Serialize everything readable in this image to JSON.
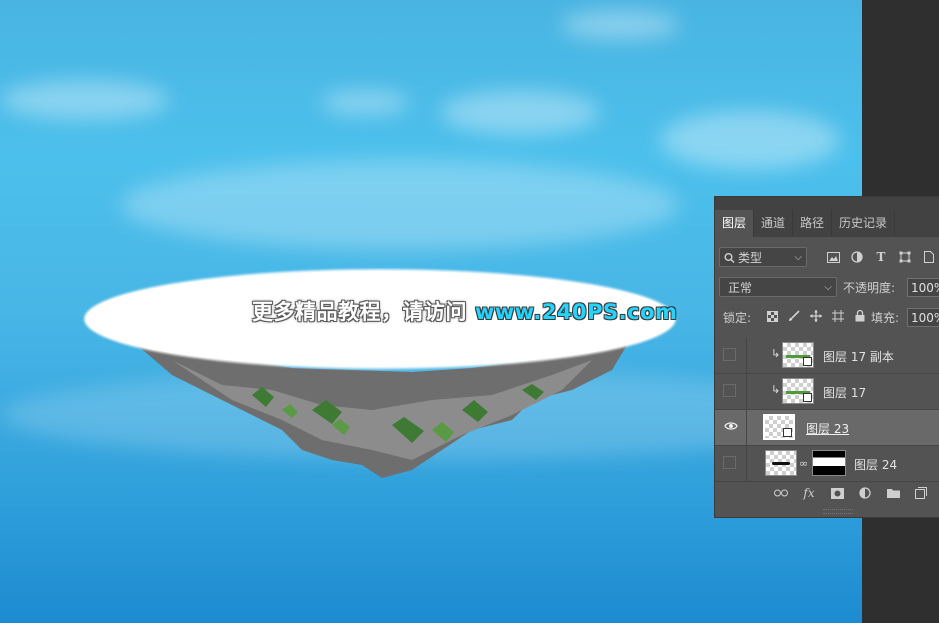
{
  "watermark": {
    "text": "更多精品教程，请访问",
    "url": "www.240PS.com"
  },
  "layers_panel": {
    "tabs": [
      {
        "label": "图层",
        "active": true
      },
      {
        "label": "通道",
        "active": false
      },
      {
        "label": "路径",
        "active": false
      },
      {
        "label": "历史记录",
        "active": false
      }
    ],
    "filter": {
      "search_icon": "search-icon",
      "kind_value": "类型"
    },
    "blend_mode": "正常",
    "opacity_label": "不透明度:",
    "opacity_value": "100%",
    "lock_label": "锁定:",
    "fill_label": "填充:",
    "fill_value": "100%",
    "layers": [
      {
        "name": "图层 17 副本",
        "visible": false,
        "clipped": true,
        "selected": false
      },
      {
        "name": "图层 17",
        "visible": false,
        "clipped": true,
        "selected": false
      },
      {
        "name": "图层 23",
        "visible": true,
        "clipped": false,
        "selected": true
      },
      {
        "name": "图层 24",
        "visible": false,
        "clipped": false,
        "selected": false,
        "has_mask": true
      }
    ],
    "footer_icons": [
      "link-icon",
      "fx-icon",
      "add-mask-icon",
      "adjustment-icon",
      "folder-icon",
      "new-layer-icon"
    ]
  }
}
